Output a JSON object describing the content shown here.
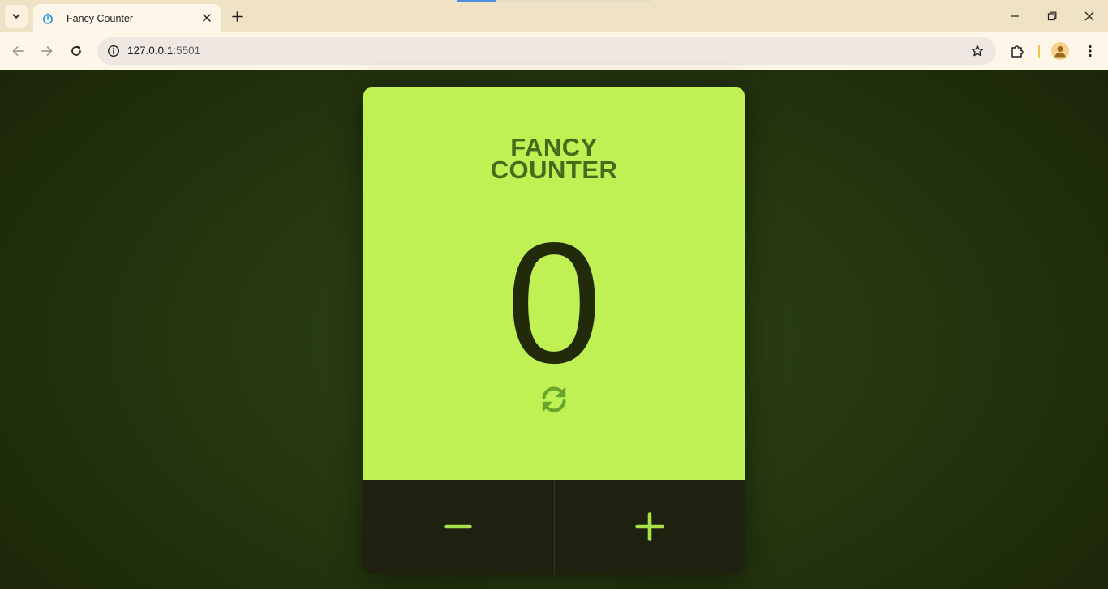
{
  "browser": {
    "tab_title": "Fancy Counter",
    "url_host": "127.0.0.1",
    "url_port": ":5501",
    "icons": {
      "tab_list": "chevron-down-icon",
      "favicon": "stopwatch-icon",
      "tab_close": "close-icon",
      "new_tab": "plus-icon",
      "back": "arrow-left-icon",
      "forward": "arrow-right-icon",
      "reload": "reload-icon",
      "site_info": "info-icon",
      "bookmark": "star-icon",
      "extensions": "puzzle-icon",
      "profile": "person-icon",
      "menu": "kebab-menu-icon",
      "minimize": "minimize-icon",
      "restore": "restore-icon",
      "close_window": "close-icon"
    }
  },
  "counter": {
    "title_line1": "FANCY",
    "title_line2": "COUNTER",
    "value": "0",
    "reset_icon": "refresh-icon",
    "decrement_icon": "minus-icon",
    "increment_icon": "plus-icon",
    "colors": {
      "card_background": "#bff155",
      "title_text": "#476a1b",
      "value_text": "#222a0c",
      "controls_background": "#1e210f",
      "control_icons": "#a6e14a",
      "page_background": "#273910"
    }
  }
}
